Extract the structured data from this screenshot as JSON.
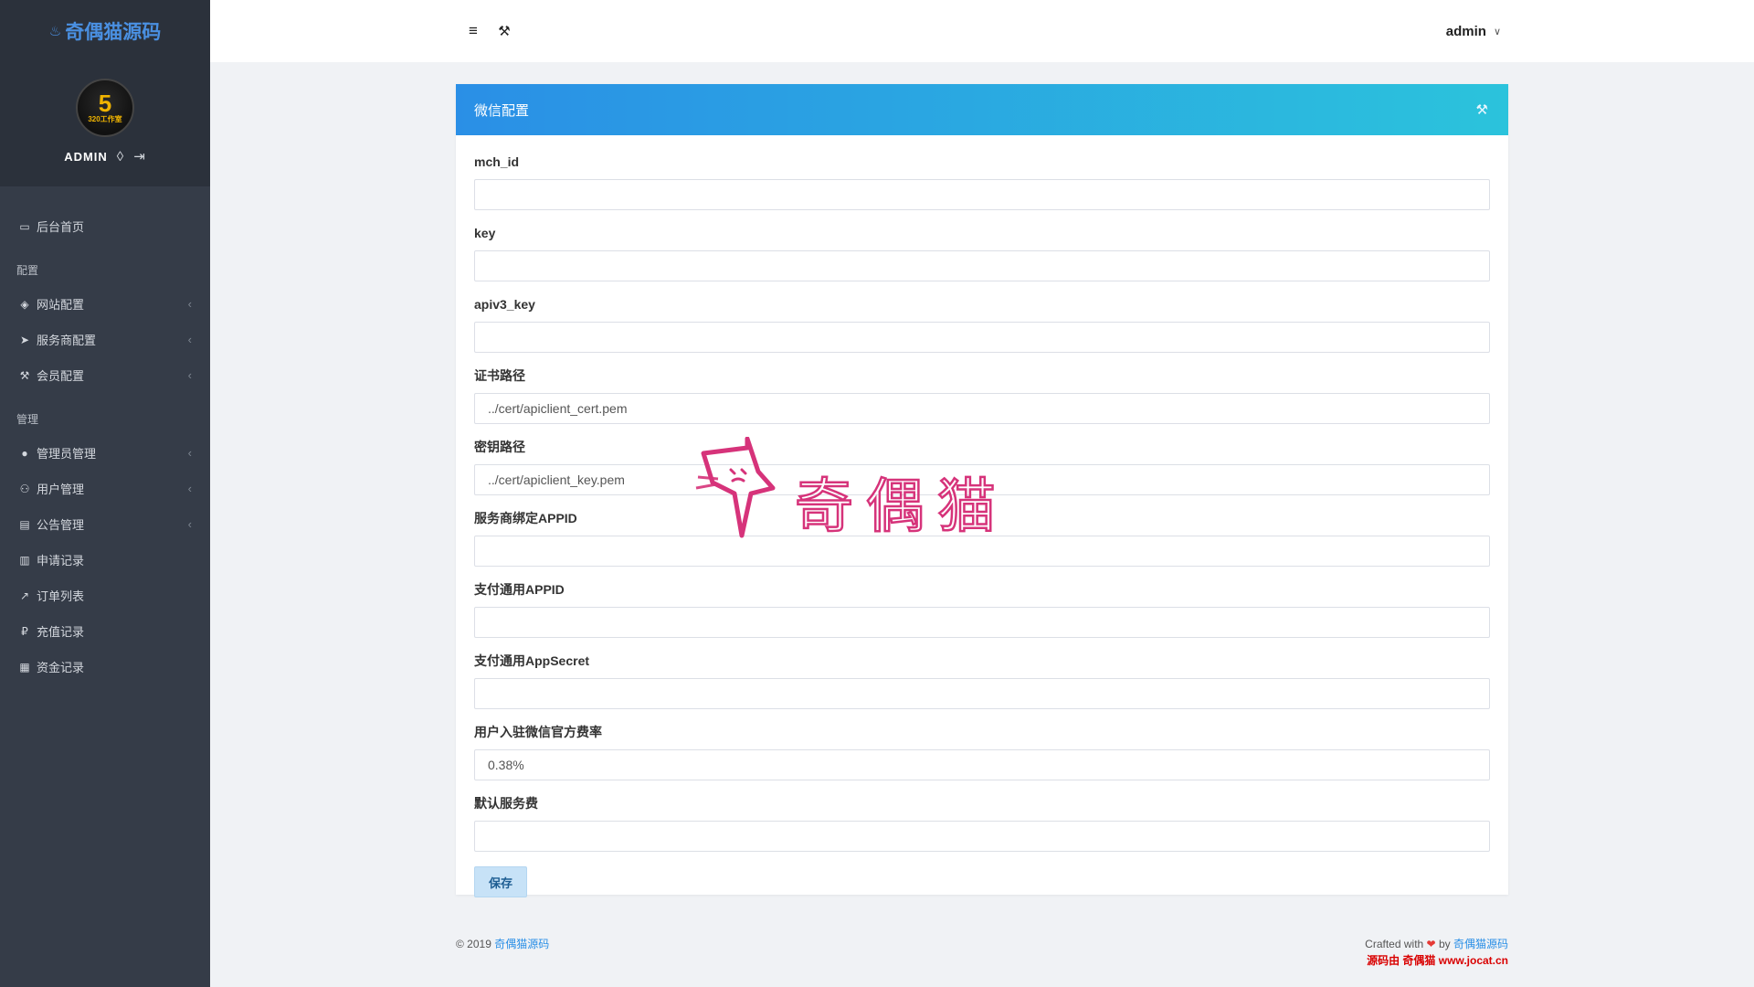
{
  "brand": {
    "name": "奇偶猫源码",
    "icon": "flame-icon",
    "color": "#4a90e2"
  },
  "profile": {
    "avatar_big": "5",
    "avatar_small": "320工作室",
    "username": "ADMIN",
    "icons": [
      "drop-icon",
      "logout-icon"
    ]
  },
  "sidebar": {
    "home": {
      "label": "后台首页",
      "icon": "home-icon"
    },
    "section_config": "配置",
    "config_items": [
      {
        "label": "网站配置",
        "icon": "tag-icon",
        "arrow": "‹"
      },
      {
        "label": "服务商配置",
        "icon": "send-icon",
        "arrow": "‹"
      },
      {
        "label": "会员配置",
        "icon": "wrench-icon",
        "arrow": "‹"
      }
    ],
    "section_manage": "管理",
    "manage_items": [
      {
        "label": "管理员管理",
        "icon": "user-icon",
        "arrow": "‹"
      },
      {
        "label": "用户管理",
        "icon": "users-icon",
        "arrow": "‹"
      },
      {
        "label": "公告管理",
        "icon": "comment-icon",
        "arrow": "‹"
      },
      {
        "label": "申请记录",
        "icon": "bar-chart-icon",
        "arrow": ""
      },
      {
        "label": "订单列表",
        "icon": "line-chart-icon",
        "arrow": ""
      },
      {
        "label": "充值记录",
        "icon": "ruble-icon",
        "arrow": ""
      },
      {
        "label": "资金记录",
        "icon": "table-icon",
        "arrow": ""
      }
    ]
  },
  "topbar": {
    "user": "admin",
    "menu_icon": "hamburger-icon",
    "tool_icon": "wrench-icon"
  },
  "card": {
    "title": "微信配置",
    "fields": [
      {
        "label": "mch_id",
        "value": ""
      },
      {
        "label": "key",
        "value": ""
      },
      {
        "label": "apiv3_key",
        "value": ""
      },
      {
        "label": "证书路径",
        "value": "../cert/apiclient_cert.pem"
      },
      {
        "label": "密钥路径",
        "value": "../cert/apiclient_key.pem"
      },
      {
        "label": "服务商绑定APPID",
        "value": ""
      },
      {
        "label": "支付通用APPID",
        "value": ""
      },
      {
        "label": "支付通用AppSecret",
        "value": ""
      },
      {
        "label": "用户入驻微信官方费率",
        "value": "0.38%"
      },
      {
        "label": "默认服务费",
        "value": ""
      }
    ],
    "save_label": "保存"
  },
  "watermark": {
    "text": "奇偶猫",
    "color": "#d6337a"
  },
  "footer": {
    "copyright": "© 2019",
    "copyright_link": "奇偶猫源码",
    "crafted": "Crafted with",
    "by": "by",
    "crafted_link": "奇偶猫源码",
    "source_note": "源码由 奇偶猫 www.jocat.cn"
  }
}
